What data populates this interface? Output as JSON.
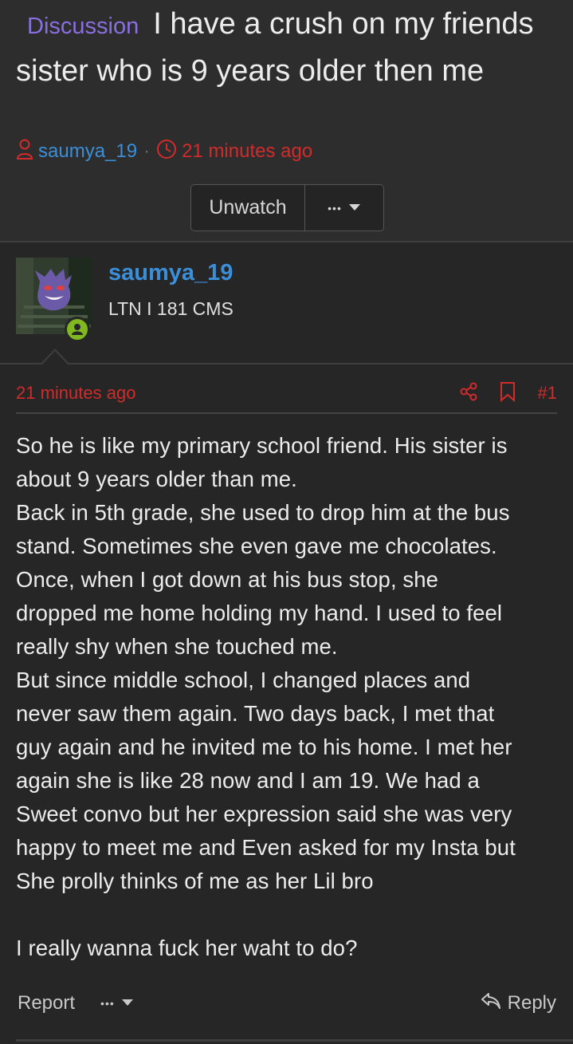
{
  "thread": {
    "prefix": "Discussion",
    "title": "I have a crush on my friends sister who is 9 years older then me",
    "author": "saumya_19",
    "time": "21 minutes ago",
    "unwatch_label": "Unwatch",
    "more_label": "•••"
  },
  "post": {
    "username": "saumya_19",
    "user_title": "LTN I 181 CMS",
    "time": "21 minutes ago",
    "number": "#1",
    "lines": [
      "So he is like my primary school friend. His sister is",
      "about 9 years older than me.",
      "Back in 5th grade, she used to drop him at the bus",
      "stand. Sometimes she even gave me chocolates.",
      "Once, when I got down at his bus stop, she",
      "dropped me home holding my hand. I used to feel",
      "really shy when she touched me.",
      "But since middle school, I changed places and",
      "never saw them again. Two days back, I met that",
      "guy again and he invited me to his home. I met her",
      "again she is like 28 now and I am 19. We had a",
      "Sweet convo but her expression said she was very",
      "happy to meet me and Even asked for my Insta but",
      "She prolly thinks of me as her Lil bro",
      "",
      "I really wanna fuck her waht to do?"
    ],
    "report_label": "Report",
    "more_label": "•••",
    "reply_label": "Reply"
  },
  "colors": {
    "accent_blue": "#3b8fd9",
    "prefix_purple": "#8a6fe0",
    "time_red": "#d22b2b",
    "online_green": "#7fb81f"
  },
  "icons": [
    "user-icon",
    "clock-icon",
    "chevron-down-icon",
    "share-icon",
    "bookmark-icon",
    "reply-icon"
  ]
}
